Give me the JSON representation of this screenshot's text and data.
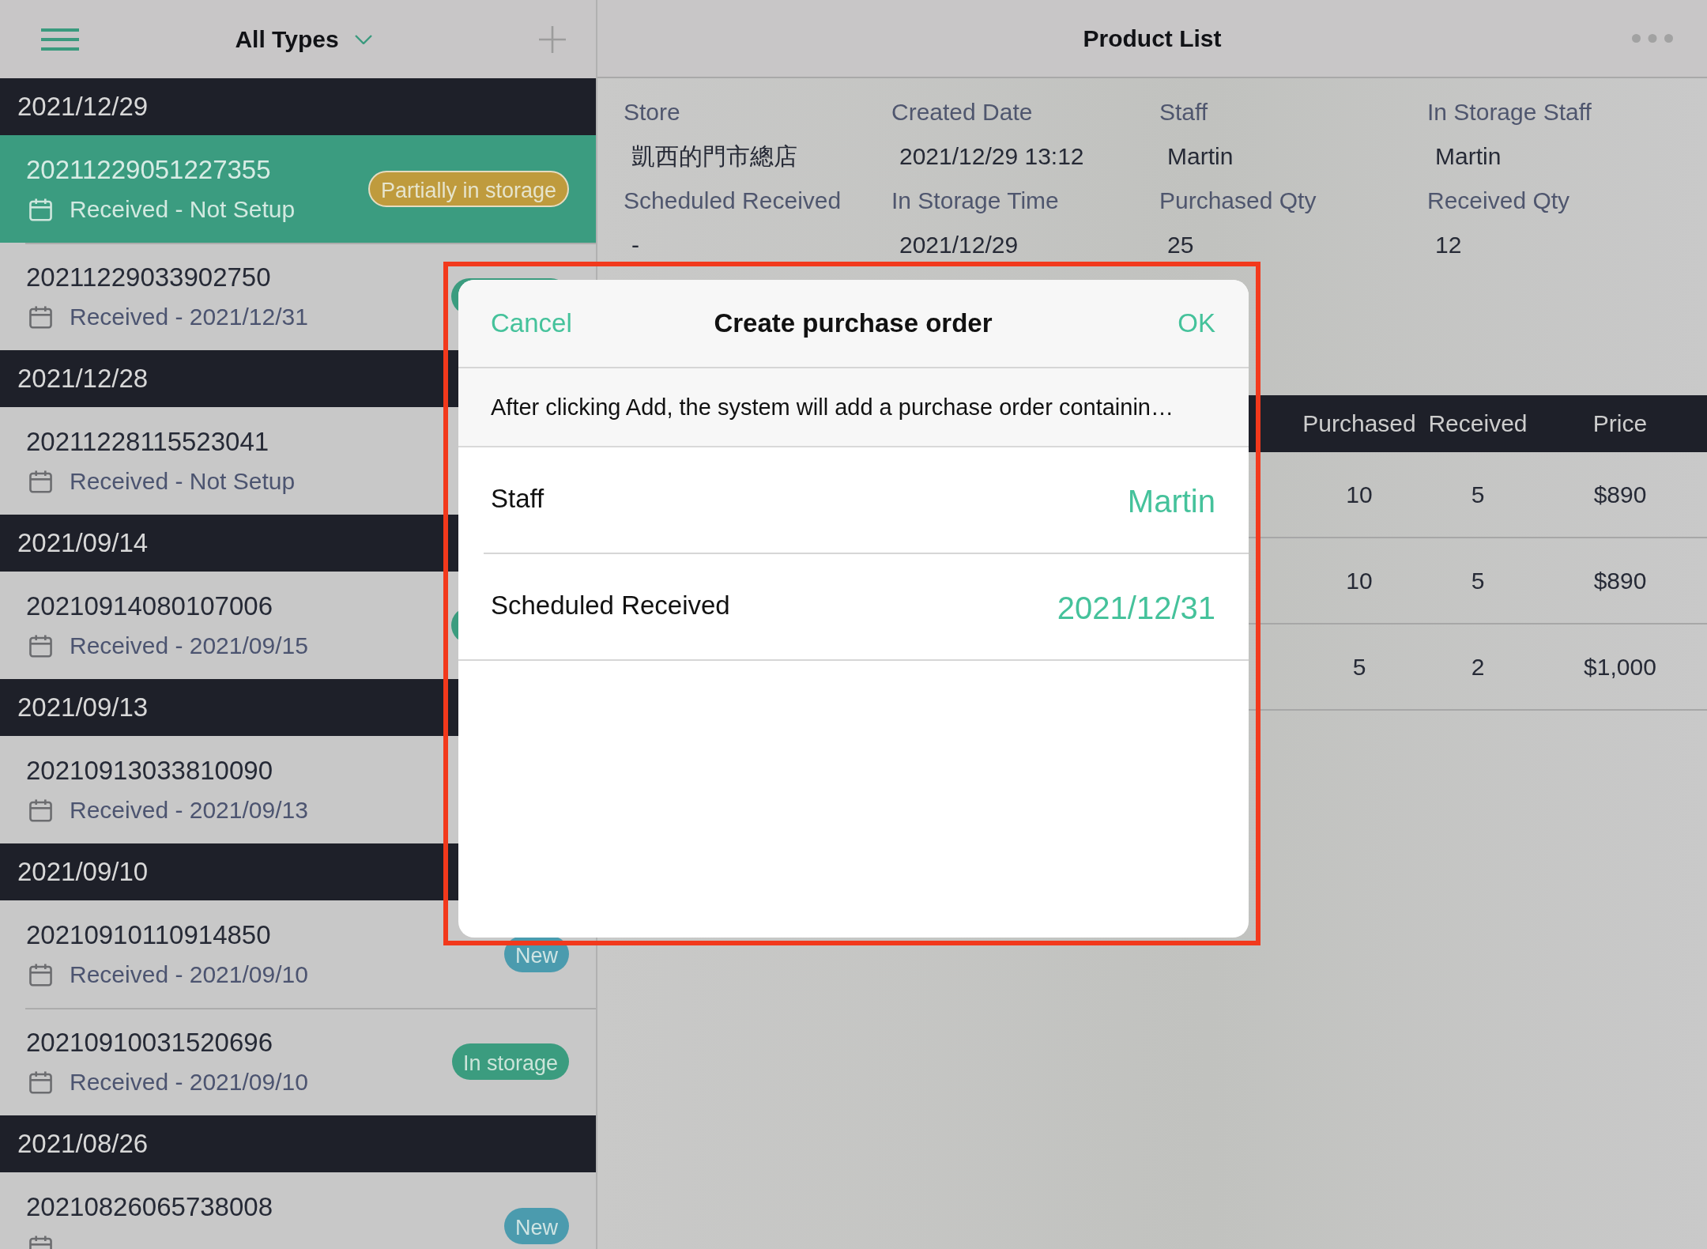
{
  "sidebar": {
    "filter": "All Types",
    "groups": [
      {
        "date": "2021/12/29",
        "orders": [
          {
            "number": "20211229051227355",
            "received": "Received - Not Setup",
            "selected": true,
            "badge": {
              "label": "Partially in storage",
              "color": "#bf9b3d"
            }
          },
          {
            "number": "20211229033902750",
            "received": "Received - 2021/12/31",
            "selected": false,
            "badge": {
              "color": "#3b9c7f"
            }
          }
        ]
      },
      {
        "date": "2021/12/28",
        "orders": [
          {
            "number": "20211228115523041",
            "received": "Received - Not Setup",
            "selected": false
          }
        ]
      },
      {
        "date": "2021/09/14",
        "orders": [
          {
            "number": "20210914080107006",
            "received": "Received - 2021/09/15",
            "selected": false,
            "badge": {
              "color": "#3b9c7f"
            }
          }
        ]
      },
      {
        "date": "2021/09/13",
        "orders": [
          {
            "number": "20210913033810090",
            "received": "Received - 2021/09/13",
            "selected": false
          }
        ]
      },
      {
        "date": "2021/09/10",
        "orders": [
          {
            "number": "20210910110914850",
            "received": "Received - 2021/09/10",
            "selected": false,
            "badge": {
              "label": "New",
              "color": "#4b9bae"
            }
          },
          {
            "number": "20210910031520696",
            "received": "Received - 2021/09/10",
            "selected": false,
            "badge": {
              "label": "In storage",
              "color": "#3b9c7f"
            }
          }
        ]
      },
      {
        "date": "2021/08/26",
        "orders": [
          {
            "number": "20210826065738008",
            "selected": false,
            "badge": {
              "label": "New",
              "color": "#4b9bae"
            }
          }
        ]
      }
    ]
  },
  "detail": {
    "title": "Product List",
    "fields": [
      {
        "label": "Store",
        "value": "凱西的門市總店"
      },
      {
        "label": "Created Date",
        "value": "2021/12/29 13:12"
      },
      {
        "label": "Staff",
        "value": "Martin"
      },
      {
        "label": "In Storage Staff",
        "value": "Martin"
      },
      {
        "label": "Scheduled Received",
        "value": "-"
      },
      {
        "label": "In Storage Time",
        "value": "2021/12/29"
      },
      {
        "label": "Purchased Qty",
        "value": "25"
      },
      {
        "label": "Received Qty",
        "value": "12"
      }
    ],
    "table": {
      "columns": [
        "Purchased",
        "Received",
        "Price"
      ],
      "rows": [
        [
          "10",
          "5",
          "$890"
        ],
        [
          "10",
          "5",
          "$890"
        ],
        [
          "5",
          "2",
          "$1,000"
        ]
      ]
    }
  },
  "dialog": {
    "cancel": "Cancel",
    "title": "Create purchase order",
    "ok": "OK",
    "message": "After clicking Add, the system will add a purchase order containin…",
    "fields": [
      {
        "label": "Staff",
        "value": "Martin"
      },
      {
        "label": "Scheduled Received",
        "value": "2021/12/31"
      }
    ]
  }
}
